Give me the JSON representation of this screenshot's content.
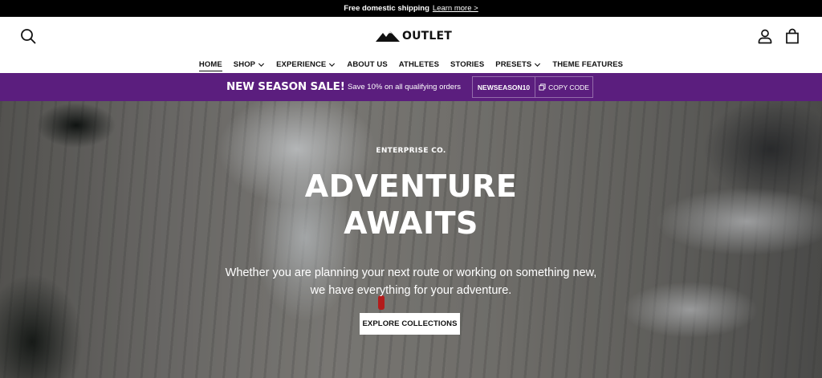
{
  "announcement": {
    "text": "Free domestic shipping",
    "link": "Learn more >"
  },
  "header": {
    "logo_text": "OUTLET",
    "icons": {
      "search": "search-icon",
      "account": "user-icon",
      "cart": "bag-icon"
    }
  },
  "nav": {
    "items": [
      {
        "label": "HOME",
        "active": true,
        "dropdown": false
      },
      {
        "label": "SHOP",
        "active": false,
        "dropdown": true
      },
      {
        "label": "EXPERIENCE",
        "active": false,
        "dropdown": true
      },
      {
        "label": "ABOUT US",
        "active": false,
        "dropdown": false
      },
      {
        "label": "ATHLETES",
        "active": false,
        "dropdown": false
      },
      {
        "label": "STORIES",
        "active": false,
        "dropdown": false
      },
      {
        "label": "PRESETS",
        "active": false,
        "dropdown": true
      },
      {
        "label": "THEME FEATURES",
        "active": false,
        "dropdown": false
      }
    ]
  },
  "promo": {
    "title": "NEW SEASON SALE!",
    "description": "Save 10% on all qualifying orders",
    "code": "NEWSEASON10",
    "copy_label": "COPY CODE",
    "background": "#5b1e7e"
  },
  "hero": {
    "eyebrow": "ENTERPRISE CO.",
    "headline_line1": "ADVENTURE",
    "headline_line2": "AWAITS",
    "subtext": "Whether you are planning your next route or working on something new, we have everything for your adventure.",
    "cta_label": "EXPLORE COLLECTIONS"
  }
}
